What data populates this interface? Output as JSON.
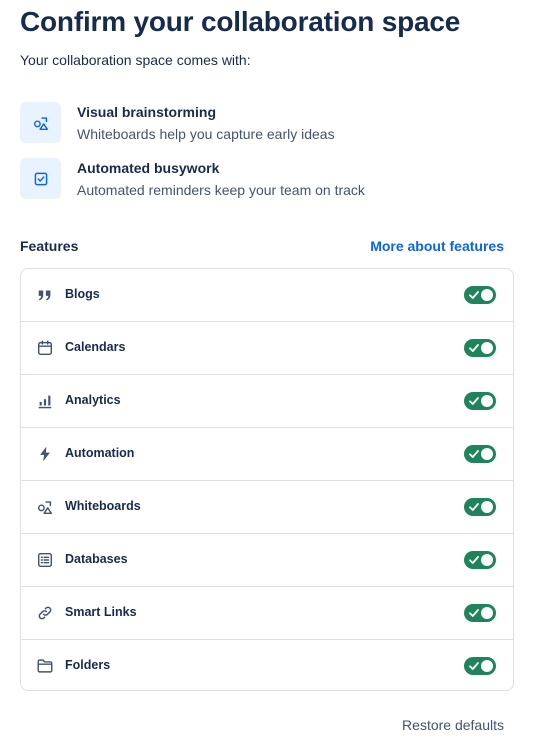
{
  "header": {
    "title": "Confirm your collaboration space",
    "subtitle": "Your collaboration space comes with:"
  },
  "perks": [
    {
      "icon": "whiteboard-shapes-icon",
      "title": "Visual brainstorming",
      "description": "Whiteboards help you capture early ideas"
    },
    {
      "icon": "checkbox-icon",
      "title": "Automated busywork",
      "description": "Automated reminders keep your team on track"
    }
  ],
  "features": {
    "label": "Features",
    "more_link": "More about features",
    "items": [
      {
        "name": "Blogs",
        "icon": "quote-icon",
        "enabled": true
      },
      {
        "name": "Calendars",
        "icon": "calendar-icon",
        "enabled": true
      },
      {
        "name": "Analytics",
        "icon": "bar-chart-icon",
        "enabled": true
      },
      {
        "name": "Automation",
        "icon": "lightning-icon",
        "enabled": true
      },
      {
        "name": "Whiteboards",
        "icon": "whiteboard-shapes-icon",
        "enabled": true
      },
      {
        "name": "Databases",
        "icon": "database-icon",
        "enabled": true
      },
      {
        "name": "Smart Links",
        "icon": "link-icon",
        "enabled": true
      },
      {
        "name": "Folders",
        "icon": "folder-icon",
        "enabled": true
      }
    ]
  },
  "footer": {
    "restore_label": "Restore defaults"
  },
  "colors": {
    "toggle_on": "#1F845A",
    "link": "#0C66E4",
    "tile_bg": "#E9F2FF",
    "text": "#172B4D"
  }
}
